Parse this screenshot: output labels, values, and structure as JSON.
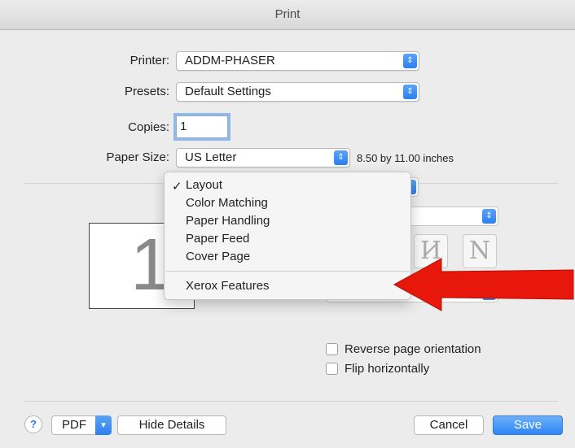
{
  "window": {
    "title": "Print"
  },
  "printer": {
    "label": "Printer:",
    "value": "ADDM-PHASER"
  },
  "presets": {
    "label": "Presets:",
    "value": "Default Settings"
  },
  "copies": {
    "label": "Copies:",
    "value": "1"
  },
  "paper_size": {
    "label": "Paper Size:",
    "value": "US Letter",
    "dimensions": "8.50 by 11.00 inches"
  },
  "preview": {
    "page_number": "1"
  },
  "section_menu": {
    "selected": "Layout",
    "check_glyph": "✓",
    "items": [
      "Layout",
      "Color Matching",
      "Paper Handling",
      "Paper Feed",
      "Cover Page"
    ],
    "extra_items": [
      "Xerox Features"
    ]
  },
  "options": {
    "reverse_orientation": {
      "label": "Reverse page orientation",
      "checked": false
    },
    "flip_horizontally": {
      "label": "Flip horizontally",
      "checked": false
    }
  },
  "footer": {
    "help_glyph": "?",
    "pdf_label": "PDF",
    "hide_details_label": "Hide Details",
    "cancel_label": "Cancel",
    "save_label": "Save"
  },
  "colors": {
    "accent": "#2f86f3",
    "annotation_arrow": "#e8170c"
  },
  "icons": [
    "popup-stepper-icon",
    "chevron-down-icon",
    "help-icon",
    "checkmark-icon",
    "red-arrow-annotation"
  ]
}
